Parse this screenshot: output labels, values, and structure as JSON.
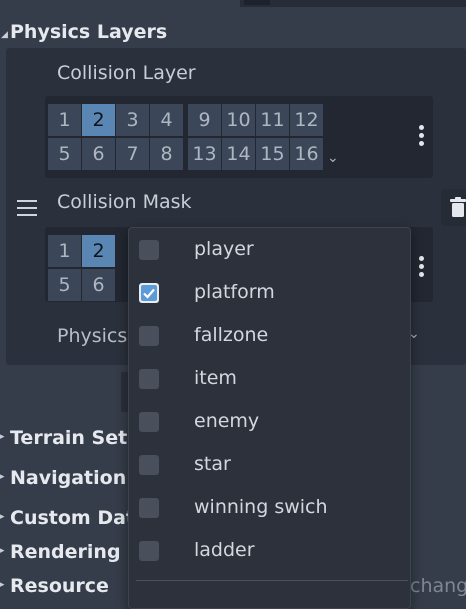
{
  "sections": {
    "physics_layers": "Physics Layers",
    "terrain_sets": "Terrain Sets",
    "navigation": "Navigation",
    "custom_data": "Custom Data",
    "rendering": "Rendering",
    "resource": "Resource"
  },
  "collision_layer": {
    "label": "Collision Layer",
    "cells_row1": [
      "1",
      "2",
      "3",
      "4",
      "9",
      "10",
      "11",
      "12"
    ],
    "cells_row2": [
      "5",
      "6",
      "7",
      "8",
      "13",
      "14",
      "15",
      "16"
    ],
    "selected": [
      "2"
    ]
  },
  "collision_mask": {
    "label": "Collision Mask",
    "cells_row1": [
      "1",
      "2"
    ],
    "cells_row2": [
      "5",
      "6"
    ],
    "selected": [
      "2"
    ]
  },
  "physics_material_label": "Physics",
  "change_text": "chang",
  "popup": {
    "items": [
      {
        "label": "player",
        "checked": false
      },
      {
        "label": "platform",
        "checked": true
      },
      {
        "label": "fallzone",
        "checked": false
      },
      {
        "label": "item",
        "checked": false
      },
      {
        "label": "enemy",
        "checked": false
      },
      {
        "label": "star",
        "checked": false
      },
      {
        "label": "winning swich",
        "checked": false
      },
      {
        "label": "ladder",
        "checked": false
      }
    ]
  },
  "icons": {
    "kebab": "more-vertical-icon",
    "hamburger": "drag-handle-icon",
    "trash": "trash-icon",
    "chevron": "chevron-down-icon",
    "section_arrow": "collapse-arrow-icon"
  },
  "colors": {
    "background": "#363d4a",
    "panel": "#2b313c",
    "cell": "#3b4658",
    "cell_selected": "#5a86b3",
    "popup": "#2c313b"
  }
}
